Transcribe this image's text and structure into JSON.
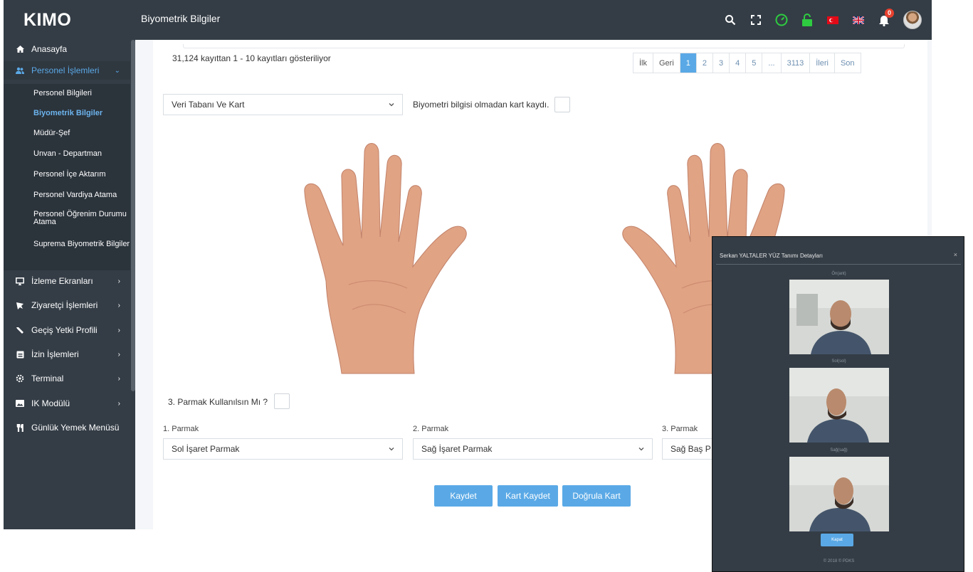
{
  "app": {
    "brand": "KIMO",
    "page_title": "Biyometrik Bilgiler"
  },
  "topbar": {
    "icons": [
      "search-icon",
      "fullscreen-icon",
      "speedometer-icon",
      "unlock-icon",
      "turkish-flag-icon",
      "uk-flag-icon",
      "bell-icon",
      "user-avatar"
    ],
    "notification_count": "0"
  },
  "sidebar": {
    "items": [
      {
        "label": "Anasayfa",
        "icon": "home-icon"
      },
      {
        "label": "Personel İşlemleri",
        "icon": "users-icon",
        "active": true
      },
      {
        "label": "İzleme Ekranları",
        "icon": "monitor-icon"
      },
      {
        "label": "Ziyaretçi İşlemleri",
        "icon": "visitor-icon"
      },
      {
        "label": "Geçiş Yetki Profili",
        "icon": "key-icon"
      },
      {
        "label": "İzin İşlemleri",
        "icon": "calendar-icon"
      },
      {
        "label": "Terminal",
        "icon": "gear-icon"
      },
      {
        "label": "IK Modülü",
        "icon": "image-icon"
      },
      {
        "label": "Günlük Yemek Menüsü",
        "icon": "cutlery-icon"
      }
    ],
    "subitems": [
      "Personel Bilgileri",
      "Biyometrik Bilgiler",
      "Müdür-Şef",
      "Unvan - Departman",
      "Personel İçe Aktarım",
      "Personel Vardiya Atama",
      "Personel Öğrenim Durumu Atama",
      "Suprema Biyometrik Bilgiler"
    ]
  },
  "main": {
    "record_info": "31,124 kayıttan 1 - 10 kayıtları gösteriliyor",
    "pagination": [
      "İlk",
      "Geri",
      "1",
      "2",
      "3",
      "4",
      "5",
      "...",
      "3113",
      "İleri",
      "Son"
    ],
    "pagination_active": "1",
    "mode_select": "Veri Tabanı Ve Kart",
    "card_only_label": "Biyometri bilgisi olmadan kart kaydı.",
    "third_finger_label": "3. Parmak Kullanılsın Mı ?",
    "finger_labels": [
      "1. Parmak",
      "2. Parmak",
      "3. Parmak"
    ],
    "finger_values": [
      "Sol İşaret Parmak",
      "Sağ İşaret Parmak",
      "Sağ Baş P"
    ],
    "buttons": {
      "save": "Kaydet",
      "save_card": "Kart Kaydet",
      "verify_card": "Doğrula Kart"
    }
  },
  "modal": {
    "title": "Serkan YALTALER YÜZ Tanımı Detayları",
    "close": "×",
    "captions": [
      "Ön(ant)",
      "Sol(sol)",
      "Sağ(sağ)"
    ],
    "button": "Kapat",
    "footer": "© 2018 © PDKS"
  }
}
